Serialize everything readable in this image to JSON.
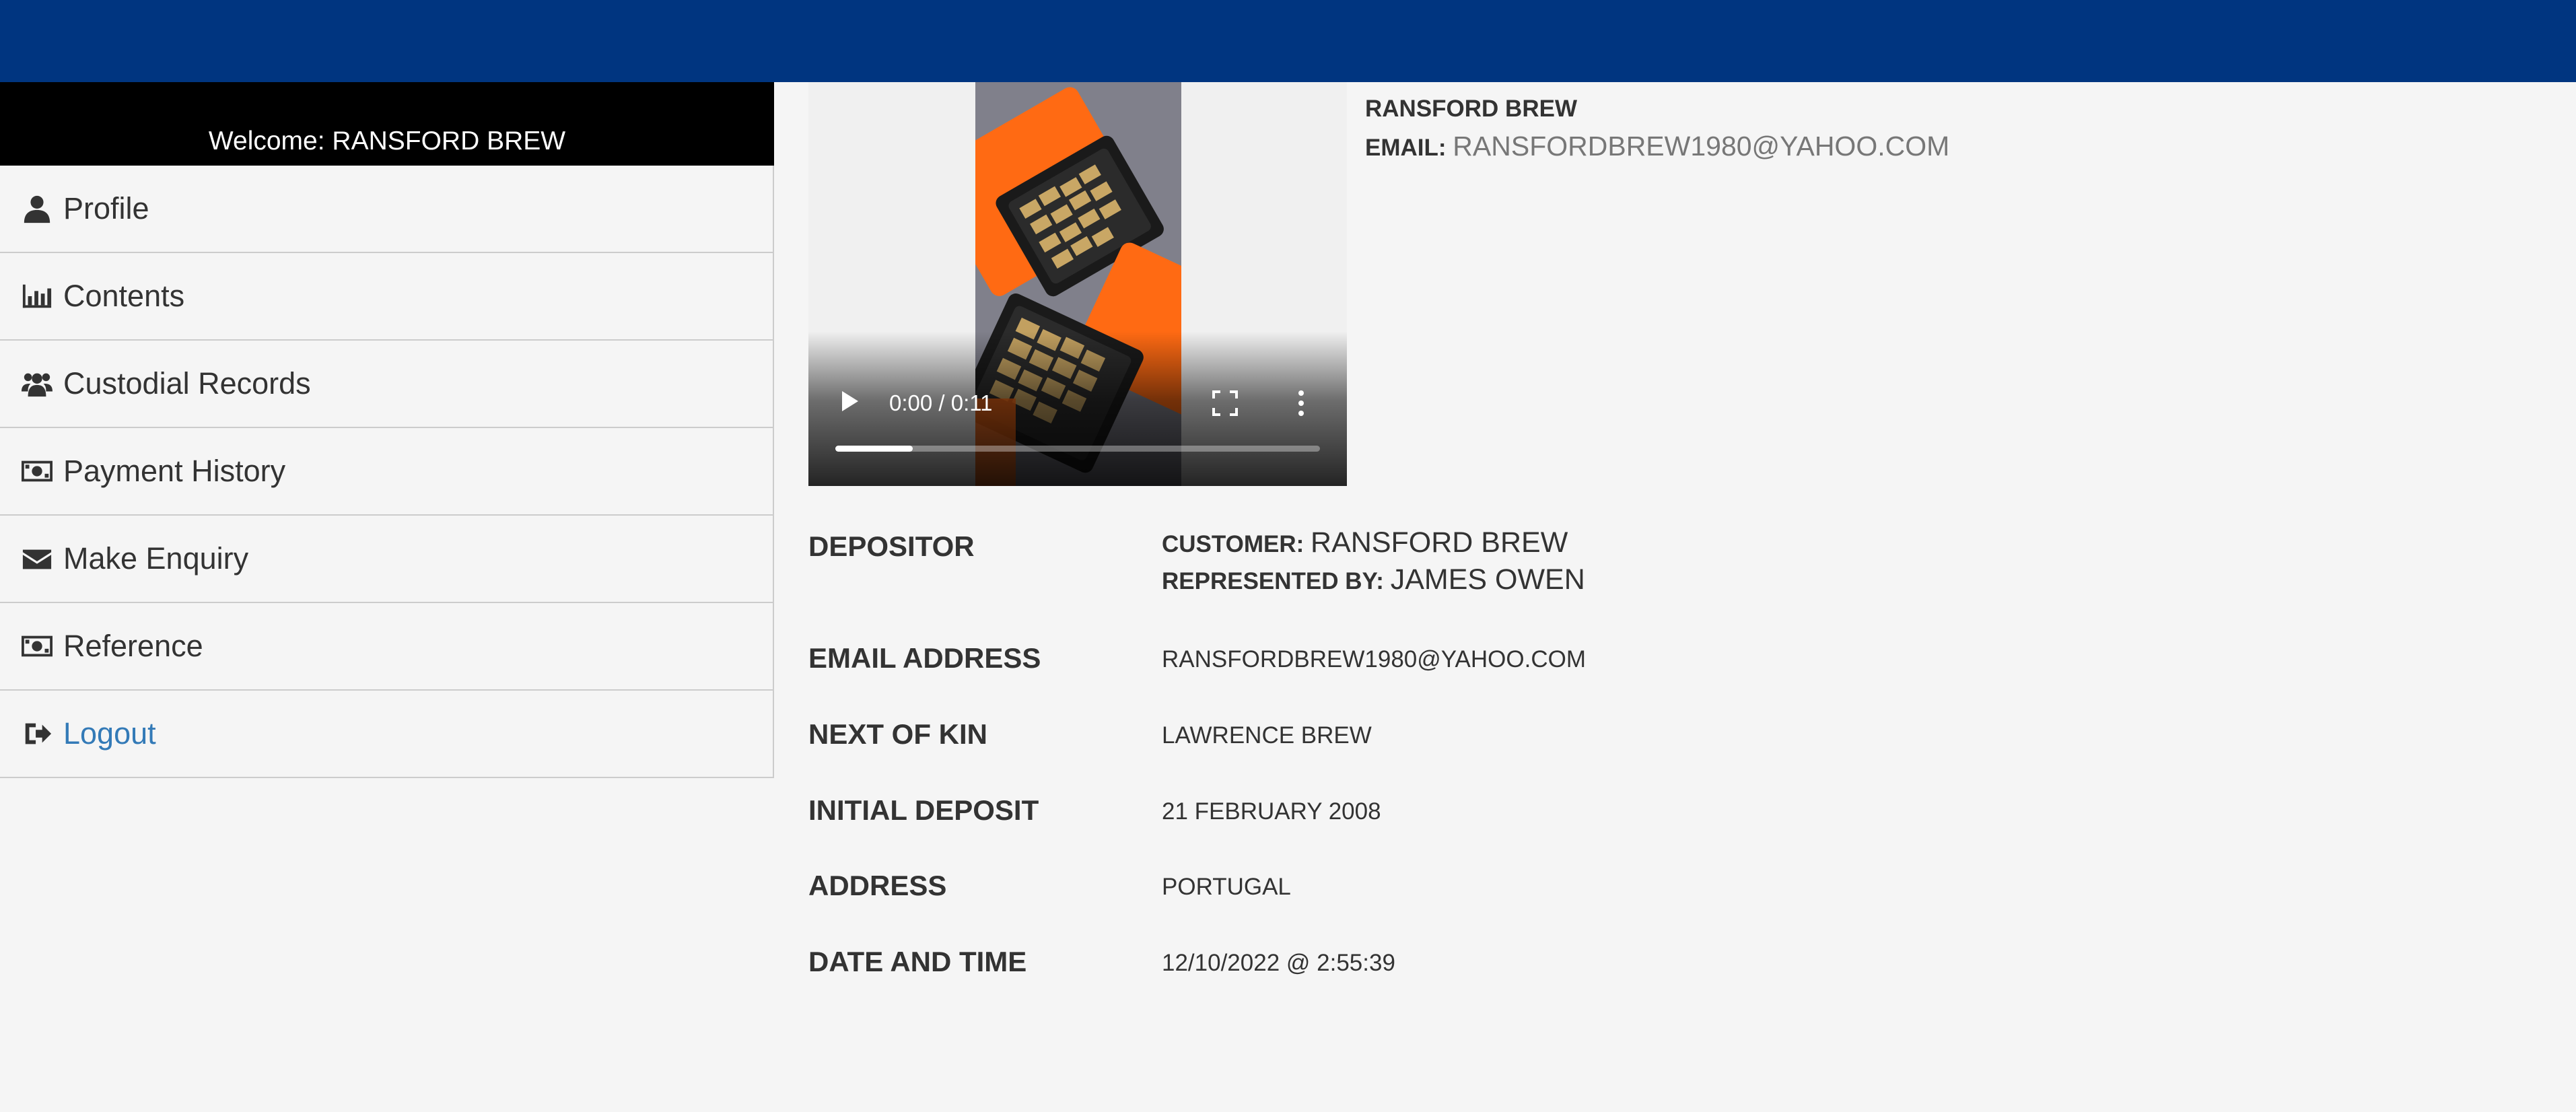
{
  "welcome": {
    "label": "Welcome: RANSFORD BREW"
  },
  "menu": {
    "items": [
      {
        "label": "Profile",
        "icon": "user-icon"
      },
      {
        "label": "Contents",
        "icon": "bar-chart-icon"
      },
      {
        "label": "Custodial Records",
        "icon": "users-icon"
      },
      {
        "label": "Payment History",
        "icon": "money-icon"
      },
      {
        "label": "Make Enquiry",
        "icon": "envelope-icon"
      },
      {
        "label": "Reference",
        "icon": "money-icon"
      },
      {
        "label": "Logout",
        "icon": "sign-out-icon"
      }
    ]
  },
  "video": {
    "time": "0:00 / 0:11",
    "progress_buffered": 0.16
  },
  "header": {
    "name": "RANSFORD BREW",
    "email_label": "EMAIL:",
    "email_value": "RANSFORDBREW1980@YAHOO.COM"
  },
  "details": {
    "depositor_label": "DEPOSITOR",
    "customer_key": "CUSTOMER:",
    "customer_value": "RANSFORD BREW",
    "represented_key": "REPRESENTED BY:",
    "represented_value": "JAMES OWEN",
    "email_label": "EMAIL ADDRESS",
    "email_value": "RANSFORDBREW1980@YAHOO.COM",
    "kin_label": "NEXT OF KIN",
    "kin_value": "LAWRENCE BREW",
    "deposit_label": "INITIAL DEPOSIT",
    "deposit_value": "21 FEBRUARY 2008",
    "address_label": "ADDRESS",
    "address_value": "PORTUGAL",
    "datetime_label": "DATE AND TIME",
    "datetime_value": "12/10/2022 @ 2:55:39"
  },
  "colors": {
    "topbar": "#003580",
    "link": "#337ab7",
    "welcome_bg": "#000000"
  }
}
